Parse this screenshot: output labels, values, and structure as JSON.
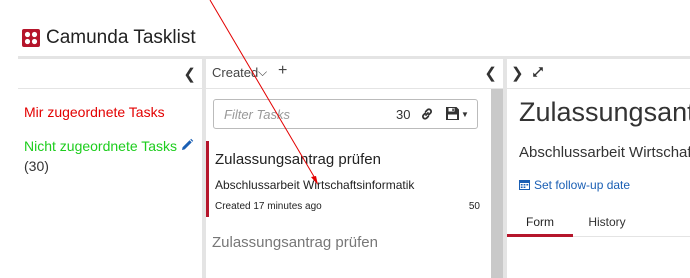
{
  "header": {
    "title": "Camunda Tasklist",
    "logo_icon": "camunda-logo-icon",
    "brand_color": "#b5152b"
  },
  "filters": {
    "mine_label": "Mir zugeordnete Tasks",
    "mine_color": "#e30000",
    "unassigned_label": "Nicht zugeordnete Tasks",
    "unassigned_color": "#1dcd1d",
    "unassigned_count": "(30)",
    "edit_icon": "pencil-icon",
    "collapse_icon": "chevron-left-icon",
    "collapse_glyph": "❮"
  },
  "list": {
    "sort_label": "Created",
    "sort_chevron": "⌵",
    "add_sort": "+",
    "collapse_glyph": "❮",
    "search": {
      "placeholder": "Filter Tasks",
      "count": "30"
    },
    "tasks": [
      {
        "name": "Zulassungsantrag prüfen",
        "process": "Abschlussarbeit Wirtschaftsinformatik",
        "created": "Created 17 minutes ago",
        "priority": "50"
      },
      {
        "name": "Zulassungsantrag prüfen"
      }
    ]
  },
  "detail": {
    "expand_glyph": "❯",
    "title": "Zulassungsantrag prüfen",
    "subtitle": "Abschlussarbeit Wirtschaftsinformatik",
    "followup_label": "Set follow-up date",
    "tabs": [
      {
        "label": "Form"
      },
      {
        "label": "History"
      }
    ]
  }
}
